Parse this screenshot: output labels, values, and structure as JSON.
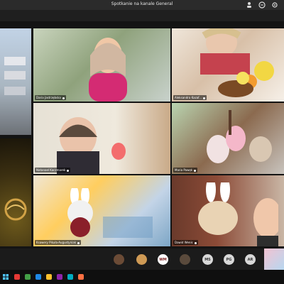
{
  "window": {
    "title": "Spotkanie na kanale General"
  },
  "participants": [
    {
      "name": "Daria Jastrzębska"
    },
    {
      "name": "Aleksandra Kazaf..."
    },
    {
      "name": "Natanael Kaczmarek"
    },
    {
      "name": "Maria Pawęk"
    },
    {
      "name": "Ksawery Pikuła-Augustyniak"
    },
    {
      "name": "Dawid Wenis"
    }
  ],
  "roster": [
    {
      "initials": "WM"
    },
    {
      "initials": "MS"
    },
    {
      "initials": "PG"
    },
    {
      "initials": "AR"
    }
  ],
  "taskbar_colors": [
    "#e53935",
    "#43a047",
    "#1e88e5",
    "#fbc02d",
    "#8e24aa",
    "#00acc1",
    "#ff7043"
  ]
}
